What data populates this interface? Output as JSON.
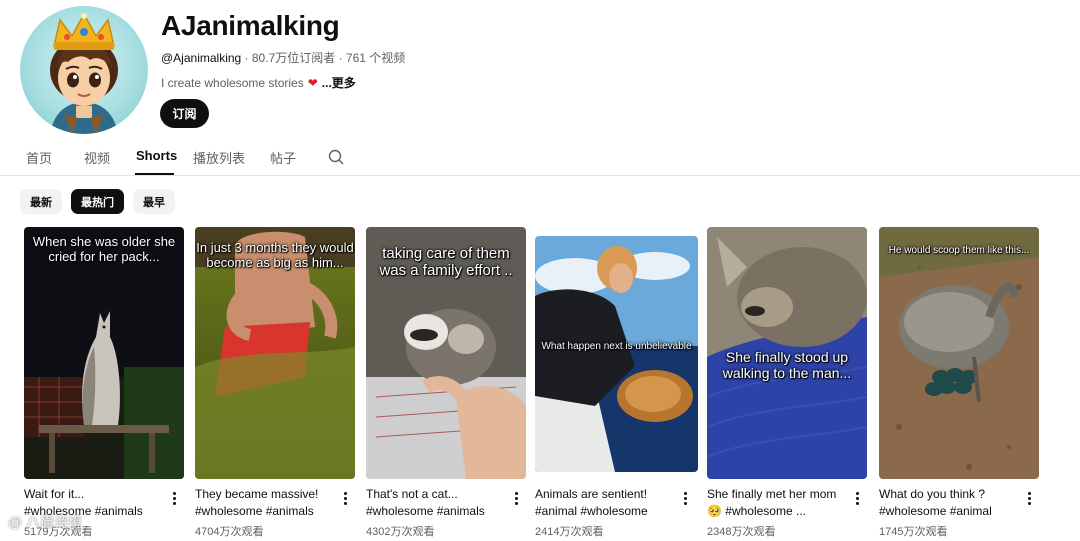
{
  "channel": {
    "name": "AJanimalking",
    "handle": "@Ajanimalking",
    "stats": " · 80.7万位订阅者 · 761 个视频",
    "description": "I create wholesome stories",
    "more": "...更多",
    "subscribe_label": "订阅"
  },
  "tabs": [
    {
      "label": "首页"
    },
    {
      "label": "视频"
    },
    {
      "label": "Shorts"
    },
    {
      "label": "播放列表"
    },
    {
      "label": "帖子"
    }
  ],
  "chips": [
    {
      "label": "最新"
    },
    {
      "label": "最热门"
    },
    {
      "label": "最早"
    }
  ],
  "shorts": [
    {
      "caption": "When she was older she cried for her pack...",
      "title_lines": [
        "Wait for it...",
        "#wholesome #animals"
      ],
      "views": "5179万次观看"
    },
    {
      "caption": "In just 3 months they would become as big as him...",
      "title_lines": [
        "They became massive!",
        "#wholesome #animals"
      ],
      "views": "4704万次观看"
    },
    {
      "caption": "taking care of them was a family effort ..",
      "title_lines": [
        "That's not a cat...",
        "#wholesome #animals"
      ],
      "views": "4302万次观看"
    },
    {
      "caption": "What happen next is unbelievable",
      "title_lines": [
        "Animals are sentient!",
        "#animal #wholesome"
      ],
      "views": "2414万次观看"
    },
    {
      "caption": "She finally stood up walking to the man...",
      "title_lines": [
        "She finally met her mom",
        "🥺 #wholesome ..."
      ],
      "views": "2348万次观看"
    },
    {
      "caption": "He would scoop them like this...",
      "title_lines": [
        "What do you think ?",
        "#wholesome #animal"
      ],
      "views": "1745万次观看"
    }
  ],
  "watermark": "@ 八眉诗境",
  "colors": {
    "accent": "#0f0f0f",
    "heart": "#e11d2f",
    "secondary_text": "#606060"
  }
}
